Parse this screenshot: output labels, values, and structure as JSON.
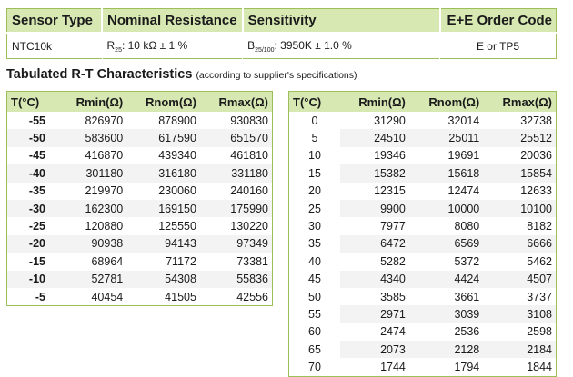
{
  "spec_table": {
    "headers": [
      "Sensor Type",
      "Nominal Resistance",
      "Sensitivity",
      "E+E Order Code"
    ],
    "sensor_type": "NTC10k",
    "resistance_symbol": "R",
    "resistance_sub": "25",
    "resistance_value": ": 10 kΩ ± 1 %",
    "sensitivity_symbol": "B",
    "sensitivity_sub": "25/100",
    "sensitivity_value": ": 3950K ± 1.0 %",
    "order_code": "E or TP5"
  },
  "rt_section": {
    "title": "Tabulated R-T Characteristics",
    "note": "(according to supplier's specifications)",
    "columns": [
      "T(°C)",
      "Rmin(Ω)",
      "Rnom(Ω)",
      "Rmax(Ω)"
    ],
    "left_rows": [
      [
        "-55",
        "826970",
        "878900",
        "930830"
      ],
      [
        "-50",
        "583600",
        "617590",
        "651570"
      ],
      [
        "-45",
        "416870",
        "439340",
        "461810"
      ],
      [
        "-40",
        "301180",
        "316180",
        "331180"
      ],
      [
        "-35",
        "219970",
        "230060",
        "240160"
      ],
      [
        "-30",
        "162300",
        "169150",
        "175990"
      ],
      [
        "-25",
        "120880",
        "125550",
        "130220"
      ],
      [
        "-20",
        "90938",
        "94143",
        "97349"
      ],
      [
        "-15",
        "68964",
        "71172",
        "73381"
      ],
      [
        "-10",
        "52781",
        "54308",
        "55836"
      ],
      [
        "-5",
        "40454",
        "41505",
        "42556"
      ]
    ],
    "right_rows": [
      [
        "0",
        "31290",
        "32014",
        "32738"
      ],
      [
        "5",
        "24510",
        "25011",
        "25512"
      ],
      [
        "10",
        "19346",
        "19691",
        "20036"
      ],
      [
        "15",
        "15382",
        "15618",
        "15854"
      ],
      [
        "20",
        "12315",
        "12474",
        "12633"
      ],
      [
        "25",
        "9900",
        "10000",
        "10100"
      ],
      [
        "30",
        "7977",
        "8080",
        "8182"
      ],
      [
        "35",
        "6472",
        "6569",
        "6666"
      ],
      [
        "40",
        "5282",
        "5372",
        "5462"
      ],
      [
        "45",
        "4340",
        "4424",
        "4507"
      ],
      [
        "50",
        "3585",
        "3661",
        "3737"
      ],
      [
        "55",
        "2971",
        "3039",
        "3108"
      ],
      [
        "60",
        "2474",
        "2536",
        "2598"
      ],
      [
        "65",
        "2073",
        "2128",
        "2184"
      ],
      [
        "70",
        "1744",
        "1794",
        "1844"
      ]
    ]
  }
}
